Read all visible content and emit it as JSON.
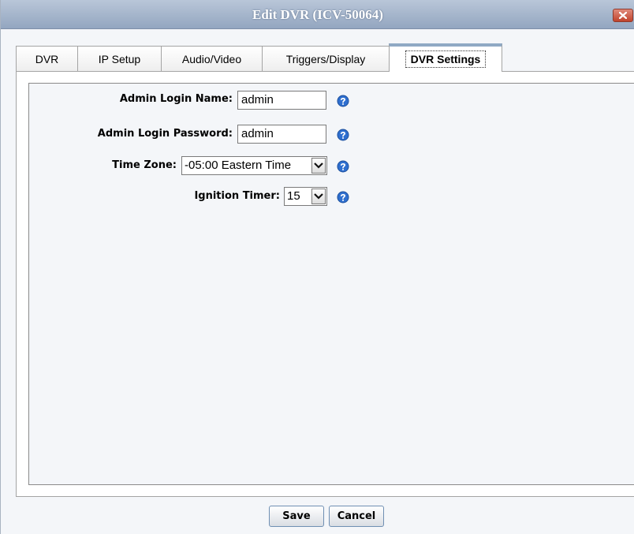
{
  "window": {
    "title": "Edit DVR (ICV-50064)"
  },
  "tabs": [
    {
      "label": "DVR"
    },
    {
      "label": "IP Setup"
    },
    {
      "label": "Audio/Video"
    },
    {
      "label": "Triggers/Display"
    },
    {
      "label": "DVR Settings",
      "active": true
    }
  ],
  "form": {
    "admin_login_name": {
      "label": "Admin Login Name:",
      "value": "admin"
    },
    "admin_login_password": {
      "label": "Admin Login Password:",
      "value": "admin"
    },
    "time_zone": {
      "label": "Time Zone:",
      "value": "-05:00 Eastern Time"
    },
    "ignition_timer": {
      "label": "Ignition Timer:",
      "value": "15"
    }
  },
  "buttons": {
    "save": "Save",
    "cancel": "Cancel"
  },
  "icons": {
    "close": "close-icon",
    "help": "help-icon",
    "dropdown": "chevron-down-icon"
  },
  "colors": {
    "titlebar": "#93a6c0",
    "help_icon": "#2f6fcf",
    "close_button": "#c0432c"
  }
}
